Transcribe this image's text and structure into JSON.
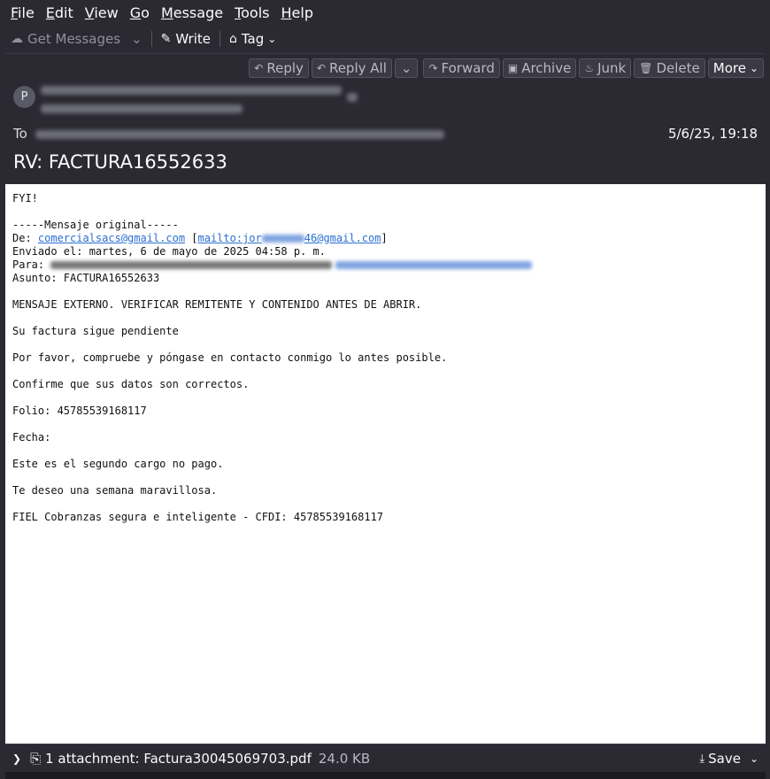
{
  "menubar": {
    "items": [
      {
        "first": "F",
        "rest": "ile"
      },
      {
        "first": "E",
        "rest": "dit"
      },
      {
        "first": "V",
        "rest": "iew"
      },
      {
        "first": "G",
        "rest": "o"
      },
      {
        "first": "M",
        "rest": "essage"
      },
      {
        "first": "T",
        "rest": "ools"
      },
      {
        "first": "H",
        "rest": "elp"
      }
    ]
  },
  "toolbar": {
    "get_messages": "Get Messages",
    "write": "Write",
    "tag": "Tag"
  },
  "header": {
    "buttons": {
      "reply": "Reply",
      "reply_all": "Reply All",
      "forward": "Forward",
      "archive": "Archive",
      "junk": "Junk",
      "delete": "Delete",
      "more": "More"
    },
    "avatar_letter": "P",
    "to_label": "To",
    "date": "5/6/25, 19:18",
    "subject": "RV: FACTURA16552633"
  },
  "body": {
    "fyi": "FYI!",
    "original": "-----Mensaje original-----",
    "de_label": "De: ",
    "de_email": "comercialsacs@gmail.com",
    "de_mailto_start": "mailto:jor",
    "de_mailto_end": "46@gmail.com",
    "enviado": "Enviado el: martes, 6 de mayo de 2025 04:58 p. m.",
    "para_label": "Para: ",
    "asunto": "Asunto: FACTURA16552633",
    "p1": "MENSAJE EXTERNO. VERIFICAR REMITENTE Y CONTENIDO ANTES DE ABRIR.",
    "p2": "Su factura sigue pendiente",
    "p3": "Por favor, compruebe y póngase en contacto conmigo lo antes posible.",
    "p4": "Confirme que sus datos son correctos.",
    "p5": "Folio: 45785539168117",
    "p6": "Fecha:",
    "p7": "Este es el segundo cargo no pago.",
    "p8": "Te deseo una semana maravillosa.",
    "p9": "FIEL Cobranzas segura e inteligente - CFDI: 45785539168117"
  },
  "attachment": {
    "label": "1 attachment: Factura30045069703.pdf",
    "size": "24.0 KB",
    "save": "Save"
  }
}
